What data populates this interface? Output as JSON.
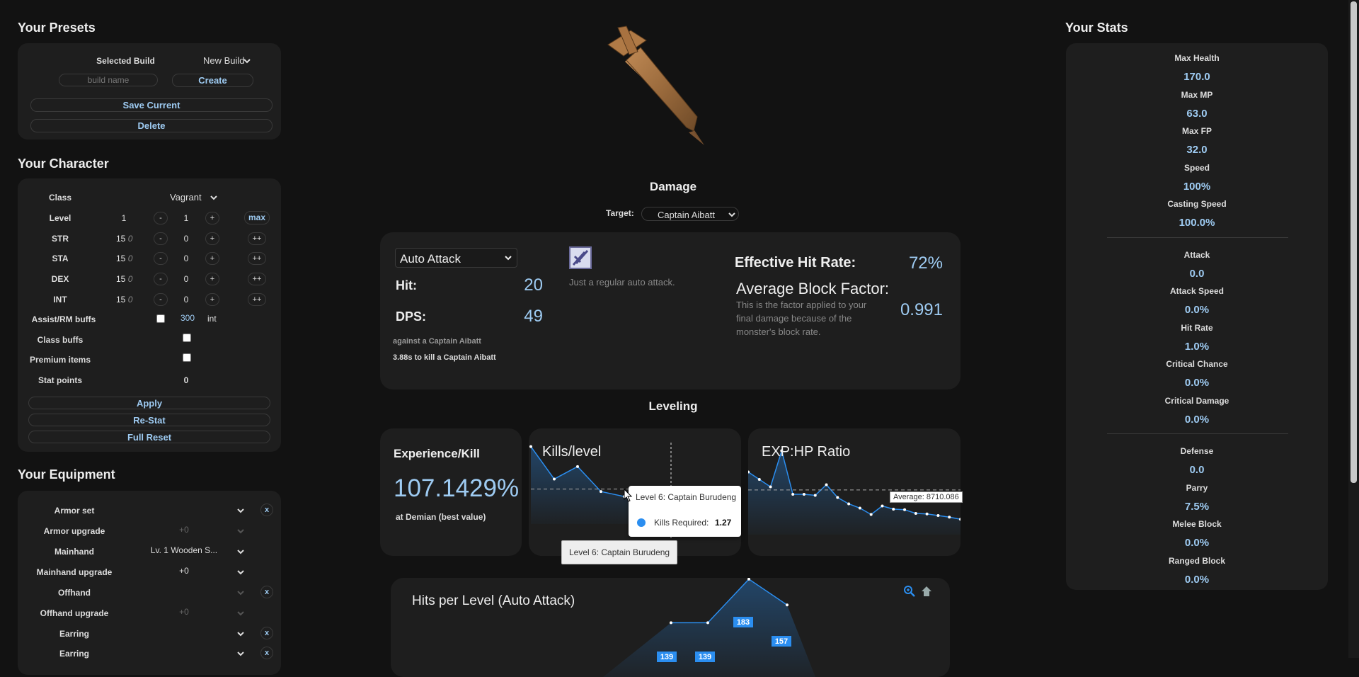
{
  "presets": {
    "title": "Your Presets",
    "selected_build_label": "Selected Build",
    "selected_build_value": "New Build",
    "build_name_placeholder": "build name",
    "create_label": "Create",
    "save_current_label": "Save Current",
    "delete_label": "Delete"
  },
  "character": {
    "title": "Your Character",
    "class_label": "Class",
    "class_value": "Vagrant",
    "level": {
      "label": "Level",
      "base": "1",
      "value": "1",
      "max_label": "max"
    },
    "stats": [
      {
        "label": "STR",
        "base": "15",
        "bonus": "0",
        "value": "0"
      },
      {
        "label": "STA",
        "base": "15",
        "bonus": "0",
        "value": "0"
      },
      {
        "label": "DEX",
        "base": "15",
        "bonus": "0",
        "value": "0"
      },
      {
        "label": "INT",
        "base": "15",
        "bonus": "0",
        "value": "0"
      }
    ],
    "minus": "-",
    "plus": "+",
    "plusplus": "++",
    "assist_label": "Assist/RM buffs",
    "assist_value": "300",
    "assist_unit": "int",
    "class_buffs_label": "Class buffs",
    "premium_label": "Premium items",
    "stat_points_label": "Stat points",
    "stat_points_value": "0",
    "apply_label": "Apply",
    "restat_label": "Re-Stat",
    "full_reset_label": "Full Reset"
  },
  "equipment": {
    "title": "Your Equipment",
    "remove_label": "x",
    "rows": [
      {
        "label": "Armor set",
        "value": ""
      },
      {
        "label": "Armor upgrade",
        "value": "+0"
      },
      {
        "label": "Mainhand",
        "value": "Lv. 1 Wooden S..."
      },
      {
        "label": "Mainhand upgrade",
        "value": "+0"
      },
      {
        "label": "Offhand",
        "value": ""
      },
      {
        "label": "Offhand upgrade",
        "value": "+0"
      },
      {
        "label": "Earring",
        "value": ""
      },
      {
        "label": "Earring",
        "value": ""
      }
    ]
  },
  "damage": {
    "title": "Damage",
    "target_label": "Target:",
    "target_value": "Captain Aibatt",
    "skill_value": "Auto Attack",
    "skill_desc": "Just a regular auto attack.",
    "hit_label": "Hit:",
    "hit_value": "20",
    "dps_label": "DPS:",
    "dps_value": "49",
    "against": "against a Captain Aibatt",
    "ttk": "3.88s to kill a Captain Aibatt",
    "ehr_label": "Effective Hit Rate:",
    "ehr_value": "72%",
    "abf_label": "Average Block Factor:",
    "abf_desc": "This is the factor applied to your final damage because of the monster's block rate.",
    "abf_value": "0.991"
  },
  "leveling": {
    "title": "Leveling",
    "exp_title": "Experience/Kill",
    "exp_value": "107.1429%",
    "exp_sub": "at Demian (best value)",
    "kills_title": "Kills/level",
    "ratio_title": "EXP:HP Ratio",
    "ratio_avg": "Average: 8710.086",
    "tooltip_title": "Level 6: Captain Burudeng",
    "tooltip_series": "Kills Required:",
    "tooltip_value": "1.27",
    "axis_tooltip": "Level 6: Captain Burudeng"
  },
  "hits_chart": {
    "title": "Hits per Level (Auto Attack)"
  },
  "chart_data": [
    {
      "type": "line",
      "title": "Kills/level",
      "x": [
        1,
        2,
        3,
        4,
        5,
        6,
        7,
        8,
        9,
        10
      ],
      "values": [
        2.35,
        1.7,
        1.95,
        1.45,
        1.35,
        1.33,
        1.27,
        1.25,
        1.26,
        1.24
      ],
      "ylim": [
        0.8,
        2.5
      ],
      "average": 1.5
    },
    {
      "type": "line",
      "title": "EXP:HP Ratio",
      "x": [
        1,
        2,
        3,
        4,
        5,
        6,
        7,
        8,
        9,
        10,
        11,
        12,
        13,
        14,
        15,
        16,
        17,
        18,
        19,
        20
      ],
      "values": [
        10400,
        9700,
        9000,
        12400,
        8300,
        8300,
        8200,
        9200,
        8000,
        7400,
        7000,
        6400,
        7200,
        6900,
        6850,
        6500,
        6450,
        6300,
        6150,
        5950
      ],
      "ylim": [
        4500,
        13500
      ],
      "average": 8710.086
    },
    {
      "type": "area",
      "title": "Hits per Level (Auto Attack)",
      "labels": [
        "139",
        "139",
        "183",
        "157"
      ],
      "values": [
        139,
        139,
        183,
        157
      ]
    }
  ],
  "stats_panel": {
    "title": "Your Stats",
    "groups": [
      [
        {
          "label": "Max Health",
          "value": "170.0"
        },
        {
          "label": "Max MP",
          "value": "63.0"
        },
        {
          "label": "Max FP",
          "value": "32.0"
        },
        {
          "label": "Speed",
          "value": "100%"
        },
        {
          "label": "Casting Speed",
          "value": "100.0%"
        }
      ],
      [
        {
          "label": "Attack",
          "value": "0.0"
        },
        {
          "label": "Attack Speed",
          "value": "0.0%"
        },
        {
          "label": "Hit Rate",
          "value": "1.0%"
        },
        {
          "label": "Critical Chance",
          "value": "0.0%"
        },
        {
          "label": "Critical Damage",
          "value": "0.0%"
        }
      ],
      [
        {
          "label": "Defense",
          "value": "0.0"
        },
        {
          "label": "Parry",
          "value": "7.5%"
        },
        {
          "label": "Melee Block",
          "value": "0.0%"
        },
        {
          "label": "Ranged Block",
          "value": "0.0%"
        }
      ]
    ]
  },
  "colors": {
    "accent": "#9ecbf2",
    "panel": "#1e1e1e",
    "bg": "#121212",
    "series": "#2b8ef0"
  },
  "icons": [
    "chevron-down-icon",
    "zoom-icon",
    "home-icon",
    "sword-icon",
    "skill-icon"
  ]
}
